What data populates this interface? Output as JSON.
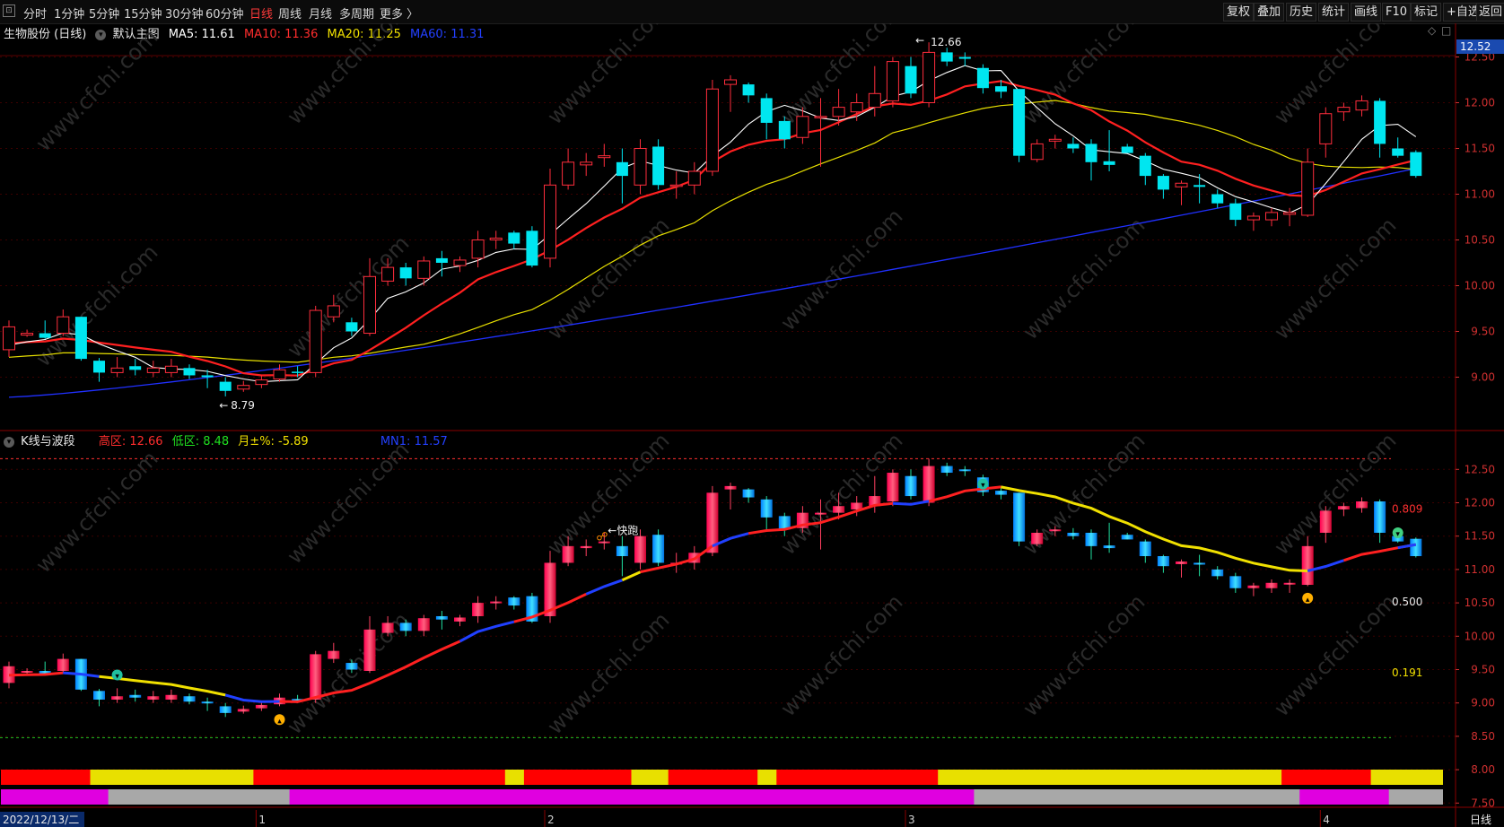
{
  "toolbar": {
    "icon_glyph": "⊡",
    "periods": [
      "分时",
      "1分钟",
      "5分钟",
      "15分钟",
      "30分钟",
      "60分钟",
      "日线",
      "周线",
      "月线",
      "多周期",
      "更多 〉"
    ],
    "active_period": "日线",
    "right_buttons": [
      "复权",
      "叠加",
      "历史",
      "统计",
      "画线",
      "F10",
      "标记",
      "+自选",
      "返回"
    ]
  },
  "main_chart": {
    "title": "生物股份 (日线)",
    "indicator_name": "默认主图",
    "ma": [
      {
        "label": "MA5: 11.61",
        "color": "#ffffff"
      },
      {
        "label": "MA10: 11.36",
        "color": "#ff2d2d"
      },
      {
        "label": "MA20: 11.25",
        "color": "#f0e000"
      },
      {
        "label": "MA60: 11.31",
        "color": "#2340ff"
      }
    ],
    "high_marker": "12.66",
    "low_marker": "8.79",
    "current_price": "12.52",
    "price_ticks": [
      "12.50",
      "12.00",
      "11.50",
      "11.00",
      "10.50",
      "10.00",
      "9.50",
      "9.00"
    ]
  },
  "sub_chart": {
    "title": "K线与波段",
    "high_label": "高区: 12.66",
    "low_label": "低区: 8.48",
    "month_label": "月±%: -5.89",
    "mn1_label": "MN1: 11.57",
    "fast_run_label": "←快跑",
    "fib_levels": [
      {
        "label": "0.809",
        "color": "#ff3030"
      },
      {
        "label": "0.500",
        "color": "#e8e8e8"
      },
      {
        "label": "0.191",
        "color": "#f0e000"
      }
    ],
    "price_ticks": [
      "12.50",
      "12.00",
      "11.50",
      "11.00",
      "10.50",
      "10.00",
      "9.50",
      "9.00",
      "8.50",
      "8.00",
      "7.50"
    ]
  },
  "bottom_axis": {
    "date_label": "2022/12/13/二",
    "month_ticks": [
      "1",
      "2",
      "3",
      "4"
    ],
    "period_label": "日线"
  },
  "colors": {
    "up": "#ff2d3c",
    "down": "#00e6f0",
    "ma5": "#ffffff",
    "ma10": "#ff2020",
    "ma20": "#e8e000",
    "ma60": "#2030ff",
    "grid": "#5a0000",
    "band_red": "#ff0000",
    "band_yellow": "#e8e000",
    "band_magenta": "#e000e0",
    "band_gray": "#a8a8a8"
  },
  "chart_data": {
    "type": "candlestick",
    "symbol": "生物股份",
    "period": "日线",
    "candles": [
      [
        9.3,
        9.55,
        9.62,
        9.22
      ],
      [
        9.46,
        9.48,
        9.52,
        9.44
      ],
      [
        9.48,
        9.43,
        9.62,
        9.42
      ],
      [
        9.48,
        9.66,
        9.74,
        9.45
      ],
      [
        9.66,
        9.2,
        9.66,
        9.18
      ],
      [
        9.18,
        9.05,
        9.21,
        8.95
      ],
      [
        9.05,
        9.1,
        9.22,
        9.0
      ],
      [
        9.12,
        9.08,
        9.2,
        9.02
      ],
      [
        9.05,
        9.1,
        9.18,
        9.0
      ],
      [
        9.05,
        9.12,
        9.2,
        9.0
      ],
      [
        9.1,
        9.02,
        9.14,
        8.98
      ],
      [
        9.02,
        9.0,
        9.08,
        8.88
      ],
      [
        8.95,
        8.85,
        9.0,
        8.79
      ],
      [
        8.87,
        8.91,
        8.96,
        8.84
      ],
      [
        8.92,
        8.97,
        9.02,
        8.88
      ],
      [
        8.98,
        9.08,
        9.14,
        8.95
      ],
      [
        9.06,
        9.05,
        9.12,
        9.0
      ],
      [
        9.05,
        9.73,
        9.78,
        9.0
      ],
      [
        9.66,
        9.78,
        9.9,
        9.6
      ],
      [
        9.6,
        9.5,
        9.65,
        9.45
      ],
      [
        9.48,
        10.1,
        10.3,
        9.45
      ],
      [
        10.05,
        10.2,
        10.3,
        10.0
      ],
      [
        10.2,
        10.08,
        10.25,
        10.0
      ],
      [
        10.08,
        10.27,
        10.32,
        10.0
      ],
      [
        10.3,
        10.25,
        10.38,
        10.1
      ],
      [
        10.22,
        10.28,
        10.32,
        10.15
      ],
      [
        10.3,
        10.5,
        10.6,
        10.2
      ],
      [
        10.5,
        10.52,
        10.6,
        10.4
      ],
      [
        10.58,
        10.46,
        10.6,
        10.4
      ],
      [
        10.6,
        10.22,
        10.65,
        10.2
      ],
      [
        10.3,
        11.1,
        11.28,
        10.2
      ],
      [
        11.1,
        11.35,
        11.5,
        11.05
      ],
      [
        11.32,
        11.35,
        11.45,
        11.2
      ],
      [
        11.4,
        11.42,
        11.55,
        11.3
      ],
      [
        11.35,
        11.2,
        11.5,
        10.9
      ],
      [
        11.1,
        11.5,
        11.6,
        11.0
      ],
      [
        11.52,
        11.1,
        11.6,
        11.05
      ],
      [
        11.1,
        11.1,
        11.25,
        10.95
      ],
      [
        11.1,
        11.25,
        11.35,
        11.0
      ],
      [
        11.25,
        12.15,
        12.25,
        11.2
      ],
      [
        12.2,
        12.25,
        12.3,
        11.9
      ],
      [
        12.2,
        12.08,
        12.22,
        12.0
      ],
      [
        12.05,
        11.78,
        12.1,
        11.6
      ],
      [
        11.8,
        11.6,
        11.85,
        11.5
      ],
      [
        11.62,
        11.85,
        11.95,
        11.55
      ],
      [
        11.85,
        11.85,
        12.05,
        11.3
      ],
      [
        11.85,
        11.95,
        12.15,
        11.75
      ],
      [
        11.9,
        12.0,
        12.1,
        11.8
      ],
      [
        11.95,
        12.1,
        12.4,
        11.85
      ],
      [
        12.02,
        12.45,
        12.5,
        11.95
      ],
      [
        12.4,
        12.1,
        12.5,
        12.05
      ],
      [
        12.0,
        12.55,
        12.66,
        11.95
      ],
      [
        12.55,
        12.45,
        12.6,
        12.4
      ],
      [
        12.5,
        12.48,
        12.55,
        12.4
      ],
      [
        12.38,
        12.16,
        12.42,
        12.1
      ],
      [
        12.18,
        12.12,
        12.25,
        12.05
      ],
      [
        12.15,
        11.42,
        12.15,
        11.35
      ],
      [
        11.38,
        11.55,
        11.6,
        11.35
      ],
      [
        11.58,
        11.6,
        11.65,
        11.5
      ],
      [
        11.55,
        11.5,
        11.62,
        11.45
      ],
      [
        11.55,
        11.35,
        11.6,
        11.15
      ],
      [
        11.36,
        11.32,
        11.7,
        11.25
      ],
      [
        11.52,
        11.45,
        11.55,
        11.45
      ],
      [
        11.42,
        11.2,
        11.45,
        11.1
      ],
      [
        11.2,
        11.05,
        11.22,
        10.95
      ],
      [
        11.08,
        11.12,
        11.15,
        10.88
      ],
      [
        11.1,
        11.08,
        11.22,
        10.9
      ],
      [
        11.0,
        10.9,
        11.05,
        10.85
      ],
      [
        10.9,
        10.72,
        10.95,
        10.65
      ],
      [
        10.72,
        10.76,
        10.8,
        10.6
      ],
      [
        10.72,
        10.8,
        10.85,
        10.65
      ],
      [
        10.78,
        10.8,
        10.85,
        10.65
      ],
      [
        10.77,
        11.35,
        11.5,
        10.75
      ],
      [
        11.55,
        11.88,
        11.95,
        11.4
      ],
      [
        11.9,
        11.95,
        12.0,
        11.8
      ],
      [
        11.92,
        12.02,
        12.08,
        11.85
      ],
      [
        12.02,
        11.55,
        12.05,
        11.4
      ],
      [
        11.5,
        11.42,
        11.62,
        11.4
      ],
      [
        11.46,
        11.2,
        11.48,
        11.18
      ]
    ]
  }
}
